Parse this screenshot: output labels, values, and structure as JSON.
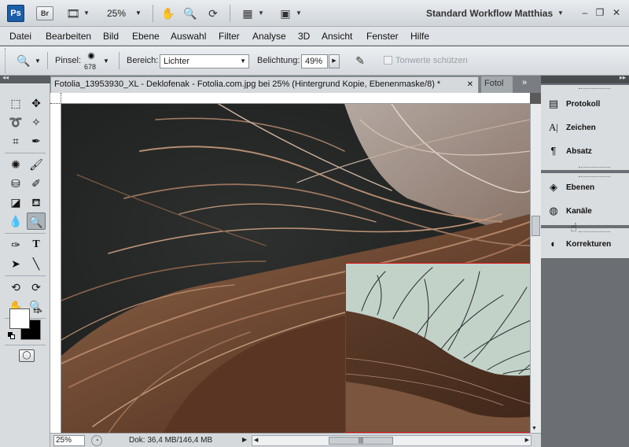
{
  "appbar": {
    "logo": "Ps",
    "bridge": "Br",
    "zoom": "25%",
    "workspace": "Standard Workflow Matthias"
  },
  "menu": [
    "Datei",
    "Bearbeiten",
    "Bild",
    "Ebene",
    "Auswahl",
    "Filter",
    "Analyse",
    "3D",
    "Ansicht",
    "Fenster",
    "Hilfe"
  ],
  "options": {
    "brush_label": "Pinsel:",
    "brush_size": "678",
    "range_label": "Bereich:",
    "range_value": "Lichter",
    "exposure_label": "Belichtung:",
    "exposure_value": "49%",
    "protect_tones": "Tonwerte schützen"
  },
  "document": {
    "tab_title": "Fotolia_13953930_XL - Deklofenak - Fotolia.com.jpg bei 25% (Hintergrund Kopie, Ebenenmaske/8) *",
    "tab2_title": "Fotol",
    "zoom": "25%",
    "doc_info": "Dok: 36,4 MB/146,4 MB"
  },
  "panels": {
    "group1": [
      "Protokoll",
      "Zeichen",
      "Absatz"
    ],
    "group2": [
      "Ebenen",
      "Kanäle"
    ],
    "group3": [
      "Korrekturen"
    ]
  }
}
